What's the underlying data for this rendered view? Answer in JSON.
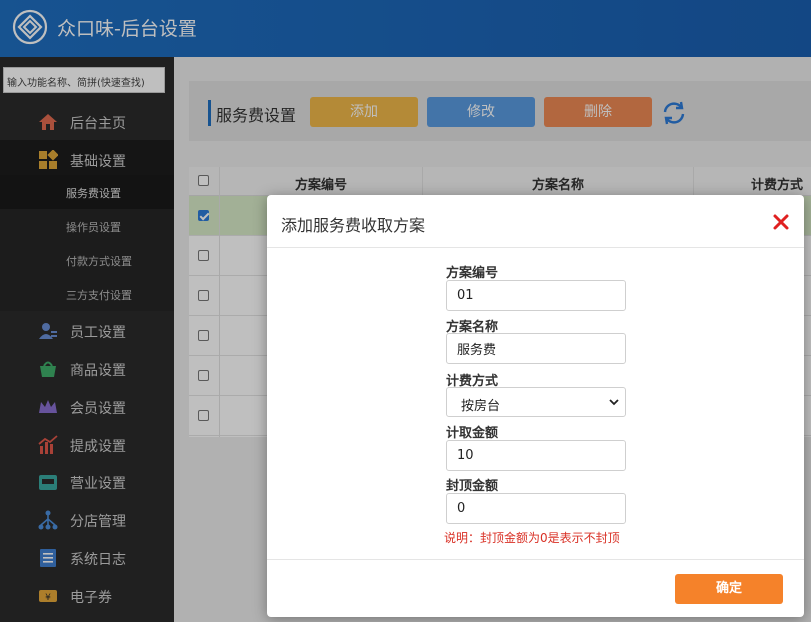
{
  "header": {
    "title": "众口味-后台设置",
    "icon": "diamond-logo-icon"
  },
  "sidebar": {
    "search_placeholder": "输入功能名称、简拼(快速查找)",
    "items": [
      {
        "label": "后台主页",
        "icon": "home-icon"
      },
      {
        "label": "基础设置",
        "icon": "puzzle-icon"
      },
      {
        "label": "员工设置",
        "icon": "employee-icon"
      },
      {
        "label": "商品设置",
        "icon": "basket-icon"
      },
      {
        "label": "会员设置",
        "icon": "crown-icon"
      },
      {
        "label": "提成设置",
        "icon": "chart-icon"
      },
      {
        "label": "营业设置",
        "icon": "store-icon"
      },
      {
        "label": "分店管理",
        "icon": "branch-icon"
      },
      {
        "label": "系统日志",
        "icon": "log-icon"
      },
      {
        "label": "电子券",
        "icon": "coupon-icon"
      }
    ],
    "sub_items": [
      {
        "label": "服务费设置"
      },
      {
        "label": "操作员设置"
      },
      {
        "label": "付款方式设置"
      },
      {
        "label": "三方支付设置"
      }
    ]
  },
  "page": {
    "title": "服务费设置",
    "buttons": {
      "add": "添加",
      "edit": "修改",
      "delete": "删除"
    }
  },
  "table": {
    "columns": [
      "方案编号",
      "方案名称",
      "计费方式"
    ]
  },
  "modal": {
    "title": "添加服务费收取方案",
    "fields": {
      "code": {
        "label": "方案编号",
        "value": "01"
      },
      "name": {
        "label": "方案名称",
        "value": "服务费"
      },
      "billing": {
        "label": "计费方式",
        "value": "按房台"
      },
      "amount": {
        "label": "计取金额",
        "value": "10"
      },
      "cap": {
        "label": "封顶金额",
        "value": "0"
      }
    },
    "note": "说明：封顶金额为0是表示不封顶",
    "confirm": "确定"
  },
  "colors": {
    "header_blue": "#1f6fc1",
    "sidebar_bg": "#2b2b2b",
    "add_btn": "#f0b84a",
    "edit_btn": "#5a9be0",
    "delete_btn": "#ee8a55",
    "confirm_btn": "#f5822a",
    "close_red": "#e02020",
    "note_red": "#d93025"
  }
}
